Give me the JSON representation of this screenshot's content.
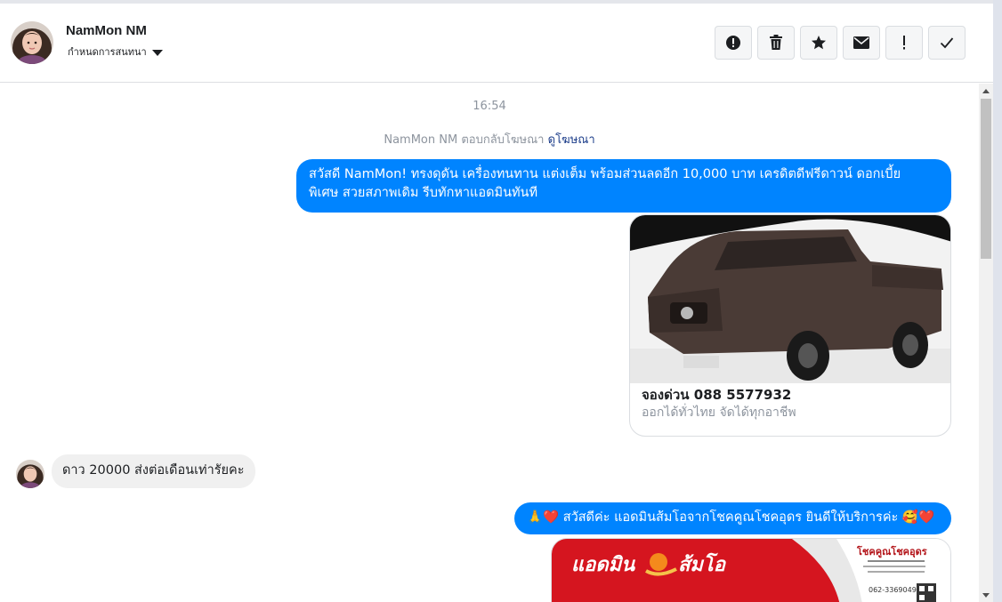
{
  "header": {
    "name": "NamMon NM",
    "assign_label": "กำหนดการสนทนา",
    "actions": [
      {
        "id": "report",
        "icon": "alert-circle-icon"
      },
      {
        "id": "delete",
        "icon": "trash-icon"
      },
      {
        "id": "star",
        "icon": "star-icon"
      },
      {
        "id": "mark-unread",
        "icon": "envelope-icon"
      },
      {
        "id": "important",
        "icon": "exclamation-icon"
      },
      {
        "id": "done",
        "icon": "checkmark-icon"
      }
    ]
  },
  "chat": {
    "timestamp": "16:54",
    "ad_reply_prefix": "NamMon NM ตอบกลับโฆษณา",
    "ad_link": "ดูโฆษณา",
    "messages": [
      {
        "from": "page",
        "text_line1": "สวัสดี NamMon!  ทรงดุดัน เครื่องทนทาน แต่งเต็ม พร้อมส่วนลดอีก 10,000 บาท เครดิตดีฟรีดาวน์ ดอกเบี้ย",
        "text_line2": "พิเศษ สวยสภาพเดิม รีบทักหาแอดมินทันที"
      },
      {
        "from": "page",
        "card_title": "จองด่วน 088 5577932",
        "card_subtitle": "ออกได้ทั่วไทย จัดได้ทุกอาชีพ"
      },
      {
        "from": "customer",
        "text": "ดาว 20000 ส่งต่อเดือนเท่ารัยคะ"
      },
      {
        "from": "page",
        "text": "🙏❤️ สวัสดีค่ะ แอดมินส้มโอจากโชคคูณโชคอุดร ยินดีให้บริการค่ะ  🥰❤️"
      },
      {
        "from": "page",
        "banner_text": "แอดมิน",
        "banner_text2": "ส้มโอ",
        "banner_brand": "โชคคูณโชคอุดร",
        "banner_phone": "062-3369049"
      }
    ]
  },
  "colors": {
    "accent": "#0084ff",
    "incoming_bubble": "#f0f0f0",
    "muted_text": "#8d949e",
    "link": "#1c3d8a"
  }
}
